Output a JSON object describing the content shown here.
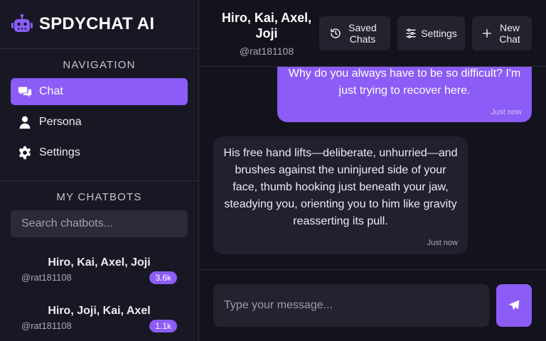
{
  "app": {
    "brand": "SPDYCHAT AI"
  },
  "sidebar": {
    "nav_title": "NAVIGATION",
    "nav_items": [
      {
        "label": "Chat",
        "icon": "chat-bubbles-icon",
        "active": true
      },
      {
        "label": "Persona",
        "icon": "person-icon",
        "active": false
      },
      {
        "label": "Settings",
        "icon": "gear-icon",
        "active": false
      }
    ],
    "chatbots_title": "MY CHATBOTS",
    "search_placeholder": "Search chatbots...",
    "bots": [
      {
        "name": "Hiro, Kai, Axel, Joji",
        "handle": "@rat181108",
        "count": "3.6k"
      },
      {
        "name": "Hiro, Joji, Kai, Axel",
        "handle": "@rat181108",
        "count": "1.1k"
      }
    ]
  },
  "header": {
    "title": "Hiro, Kai, Axel, Joji",
    "handle": "@rat181108",
    "buttons": {
      "saved": "Saved Chats",
      "settings": "Settings",
      "new": "New Chat"
    }
  },
  "messages": [
    {
      "role": "user",
      "text": "Why do you always have to be so difficult? I'm just trying to recover here.",
      "time": "Just now"
    },
    {
      "role": "bot",
      "text": "His free hand lifts—deliberate, unhurried—and brushes against the uninjured side of your face, thumb hooking just beneath your jaw, steadying you, orienting you to him like gravity reasserting its pull.",
      "time": "Just now"
    }
  ],
  "composer": {
    "placeholder": "Type your message..."
  },
  "colors": {
    "accent": "#8b5cf6",
    "background": "#13131d",
    "sidebar": "#181824"
  }
}
